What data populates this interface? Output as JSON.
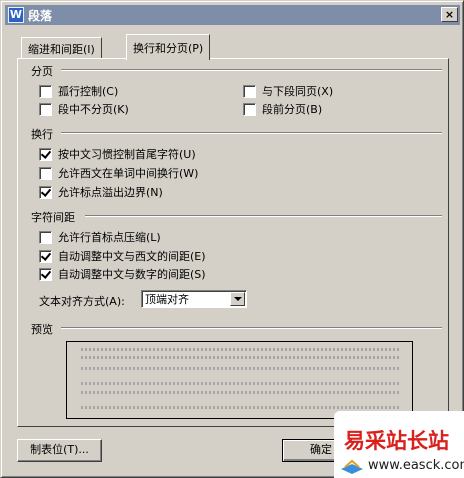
{
  "window": {
    "title": "段落",
    "close_glyph": "×",
    "icon_letter": "W"
  },
  "tabs": [
    {
      "label": "缩进和间距(I)",
      "active": false
    },
    {
      "label": "换行和分页(P)",
      "active": true
    }
  ],
  "sections": {
    "pagination": {
      "label": "分页",
      "options": [
        {
          "label": "孤行控制(C)",
          "checked": false
        },
        {
          "label": "与下段同页(X)",
          "checked": false
        },
        {
          "label": "段中不分页(K)",
          "checked": false
        },
        {
          "label": "段前分页(B)",
          "checked": false
        }
      ]
    },
    "line_break": {
      "label": "换行",
      "options": [
        {
          "label": "按中文习惯控制首尾字符(U)",
          "checked": true
        },
        {
          "label": "允许西文在单词中间换行(W)",
          "checked": false
        },
        {
          "label": "允许标点溢出边界(N)",
          "checked": true
        }
      ]
    },
    "char_spacing": {
      "label": "字符间距",
      "options": [
        {
          "label": "允许行首标点压缩(L)",
          "checked": false
        },
        {
          "label": "自动调整中文与西文的间距(E)",
          "checked": true
        },
        {
          "label": "自动调整中文与数字的间距(S)",
          "checked": true
        }
      ],
      "text_align": {
        "label": "文本对齐方式(A):",
        "value": "顶端对齐"
      }
    },
    "preview": {
      "label": "预览"
    }
  },
  "buttons": {
    "tab_stops": "制表位(T)...",
    "ok": "确定"
  },
  "watermark": {
    "title": "易采站长站",
    "url": "www.easck.com"
  }
}
